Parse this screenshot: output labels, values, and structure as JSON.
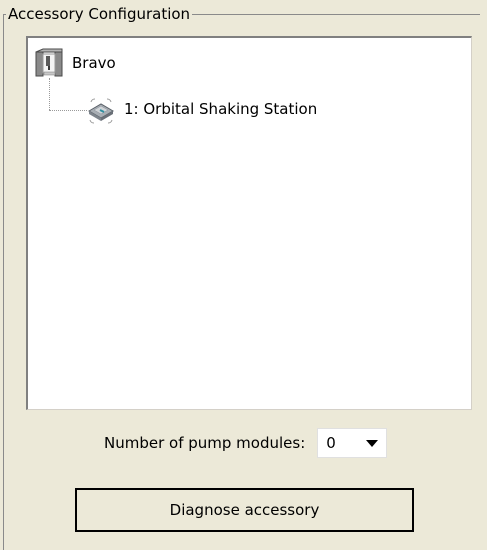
{
  "group": {
    "title": "Accessory Configuration"
  },
  "tree": {
    "root": {
      "label": "Bravo",
      "icon": "bravo-device-icon"
    },
    "children": [
      {
        "label": "1: Orbital Shaking Station",
        "icon": "shaking-station-icon"
      }
    ]
  },
  "pump": {
    "label": "Number of pump modules:",
    "value": "0",
    "options_visible": [
      "0"
    ]
  },
  "actions": {
    "diagnose_label": "Diagnose accessory"
  },
  "colors": {
    "panel_bg": "#ece9d8",
    "tree_bg": "#ffffff",
    "border": "#808080"
  }
}
